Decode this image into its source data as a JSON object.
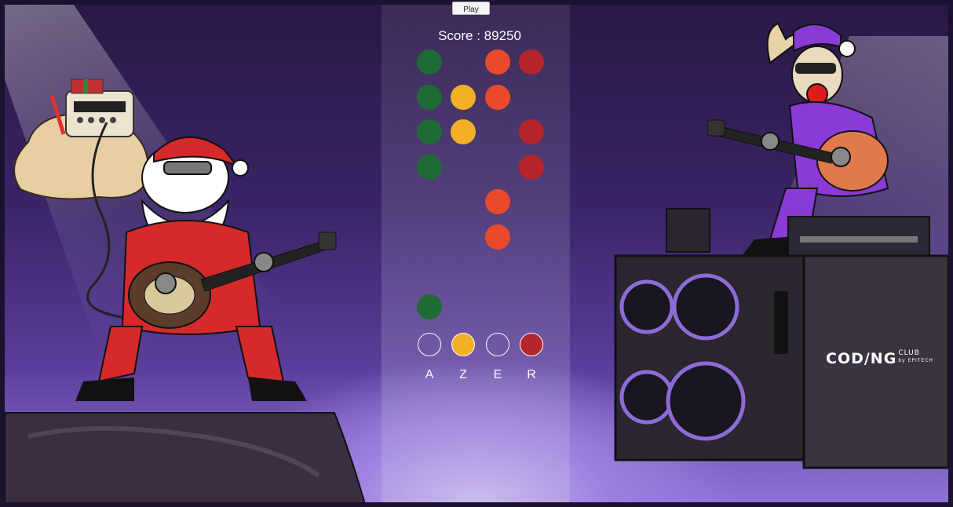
{
  "controls": {
    "play_label": "Play"
  },
  "score": {
    "label": "Score :",
    "value": "89250"
  },
  "lanes": [
    {
      "key": "A",
      "color": "#1e6b34"
    },
    {
      "key": "Z",
      "color": "#f4b025"
    },
    {
      "key": "E",
      "color": "#ea4a2c"
    },
    {
      "key": "R",
      "color": "#b5252a"
    }
  ],
  "notes": [
    {
      "lane": 0,
      "row": 0
    },
    {
      "lane": 2,
      "row": 0
    },
    {
      "lane": 3,
      "row": 0
    },
    {
      "lane": 0,
      "row": 1
    },
    {
      "lane": 1,
      "row": 1
    },
    {
      "lane": 2,
      "row": 1
    },
    {
      "lane": 0,
      "row": 2
    },
    {
      "lane": 1,
      "row": 2
    },
    {
      "lane": 3,
      "row": 2
    },
    {
      "lane": 0,
      "row": 3
    },
    {
      "lane": 3,
      "row": 3
    },
    {
      "lane": 2,
      "row": 4
    },
    {
      "lane": 2,
      "row": 5
    },
    {
      "lane": 0,
      "row": 7
    }
  ],
  "targets": [
    {
      "lane": 0,
      "lit": false
    },
    {
      "lane": 1,
      "lit": true
    },
    {
      "lane": 2,
      "lit": false
    },
    {
      "lane": 3,
      "lit": true
    }
  ],
  "logo": {
    "main": "COD/NG",
    "sub_top": "CLUB",
    "sub_bottom": "by EPITECH"
  }
}
